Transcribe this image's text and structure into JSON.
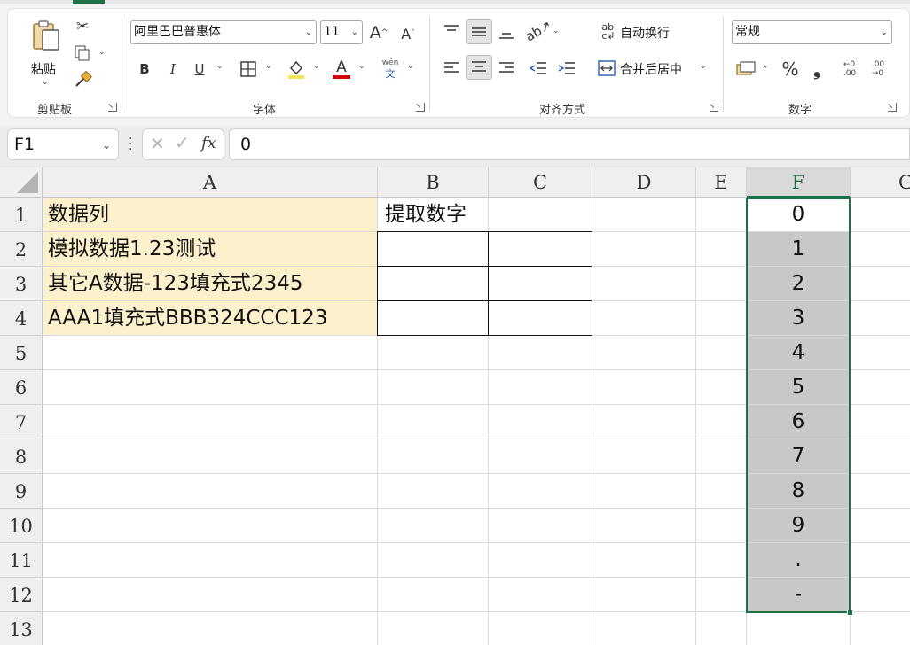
{
  "ribbon": {
    "clipboard": {
      "paste_label": "粘贴",
      "group_label": "剪贴板"
    },
    "font": {
      "font_name": "阿里巴巴普惠体",
      "font_size": "11",
      "bold": "B",
      "italic": "I",
      "underline": "U",
      "font_color_letter": "A",
      "phonetic_top": "wén",
      "phonetic_bottom": "文",
      "group_label": "字体"
    },
    "alignment": {
      "wrap_text": "自动换行",
      "merge_center": "合并后居中",
      "group_label": "对齐方式"
    },
    "number": {
      "format": "常规",
      "percent": "%",
      "comma": "❟",
      "group_label": "数字"
    }
  },
  "formula_bar": {
    "name_box": "F1",
    "fx": "fx",
    "value": "0"
  },
  "sheet": {
    "columns": [
      "A",
      "B",
      "C",
      "D",
      "E",
      "F",
      "G"
    ],
    "rows": [
      "1",
      "2",
      "3",
      "4",
      "5",
      "6",
      "7",
      "8",
      "9",
      "10",
      "11",
      "12",
      "13"
    ],
    "cells": {
      "A1": "数据列",
      "A2": "模拟数据1.23测试",
      "A3": "其它A数据-123填充式2345",
      "A4": "AAA1填充式BBB324CCC123",
      "B1": "提取数字",
      "F1": "0",
      "F2": "1",
      "F3": "2",
      "F4": "3",
      "F5": "4",
      "F6": "5",
      "F7": "6",
      "F8": "7",
      "F9": "8",
      "F10": "9",
      "F11": ".",
      "F12": "-"
    },
    "selected_range": "F1:F12",
    "colors": {
      "accent": "#1e7145",
      "data_fill": "#fdf1cd",
      "selection_fill": "#c8c8c8",
      "font_color_bar": "#d00000"
    }
  }
}
